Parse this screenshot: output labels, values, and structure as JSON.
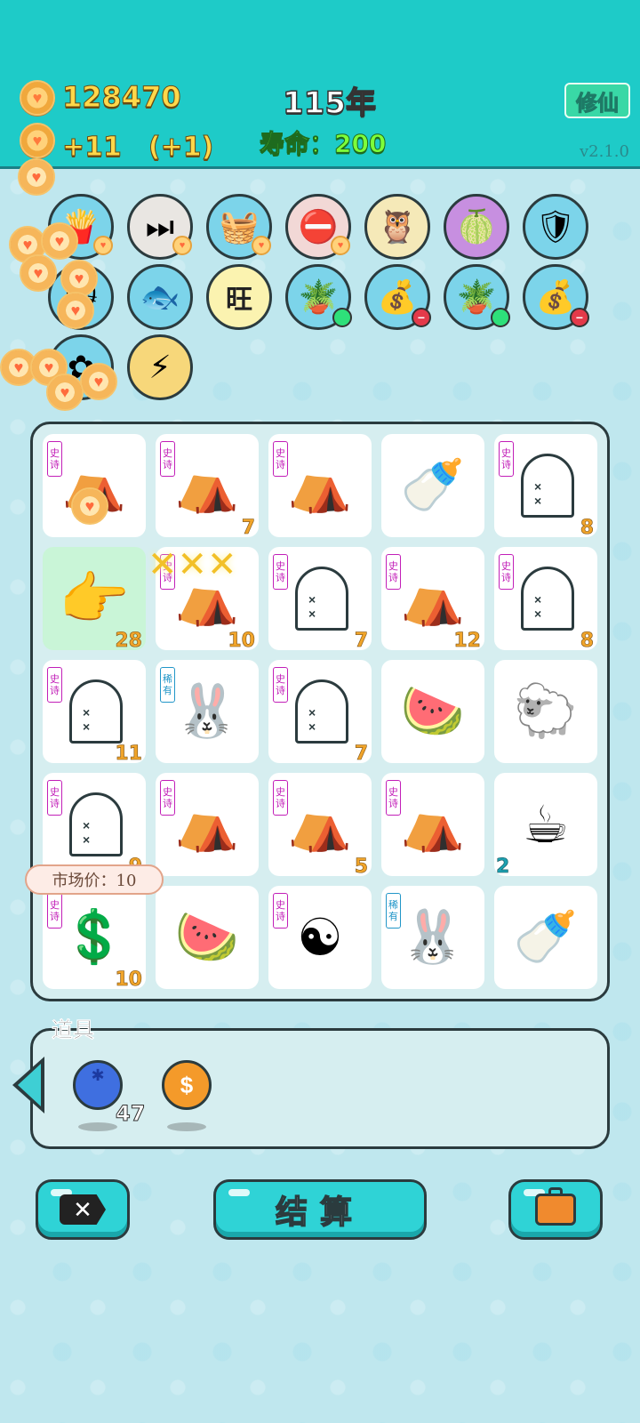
{
  "header": {
    "coins": "128470",
    "income": "+11　(+1)",
    "year": "115年",
    "lifespan": "寿命：200",
    "xiuxian_label": "修仙",
    "version": "v2.1.0"
  },
  "artifacts": [
    {
      "name": "fries",
      "icon": "🍟"
    },
    {
      "name": "skip",
      "icon": "⏭"
    },
    {
      "name": "fruit-basket",
      "icon": "🧺"
    },
    {
      "name": "no-entry",
      "icon": "⛔"
    },
    {
      "name": "owl-glasses",
      "icon": "🦉"
    },
    {
      "name": "pomelo",
      "icon": "🍈"
    },
    {
      "name": "shield",
      "icon": "🛡"
    },
    {
      "name": "cat",
      "icon": "🐱"
    },
    {
      "name": "fish-bowl",
      "icon": "🐟"
    },
    {
      "name": "wang",
      "icon": "旺"
    },
    {
      "name": "flower-pot-1",
      "icon": "🪴"
    },
    {
      "name": "bag-1",
      "icon": "💰"
    },
    {
      "name": "flower-pot-2",
      "icon": "🪴"
    },
    {
      "name": "bag-2",
      "icon": "💰"
    },
    {
      "name": "flower",
      "icon": "✿"
    },
    {
      "name": "lightning",
      "icon": "⚡"
    }
  ],
  "board": {
    "tag_epic": "史诗",
    "tag_rare": "稀有",
    "cells": [
      {
        "icon": "⛺",
        "tag": "epic",
        "num": ""
      },
      {
        "icon": "⛺",
        "tag": "epic",
        "num": "7"
      },
      {
        "icon": "⛺",
        "tag": "epic",
        "num": ""
      },
      {
        "icon": "🍼",
        "tag": "",
        "num": ""
      },
      {
        "icon": "ghost",
        "tag": "epic",
        "num": "8"
      },
      {
        "icon": "👉",
        "tag": "",
        "num": "28"
      },
      {
        "icon": "⛺",
        "tag": "epic",
        "num": "10"
      },
      {
        "icon": "ghost",
        "tag": "epic",
        "num": "7"
      },
      {
        "icon": "⛺",
        "tag": "epic",
        "num": "12"
      },
      {
        "icon": "ghost",
        "tag": "epic",
        "num": "8"
      },
      {
        "icon": "ghost",
        "tag": "epic",
        "num": "11"
      },
      {
        "icon": "🐰",
        "tag": "rare",
        "num": ""
      },
      {
        "icon": "ghost",
        "tag": "epic",
        "num": "7"
      },
      {
        "icon": "🍉",
        "tag": "",
        "num": ""
      },
      {
        "icon": "🐑",
        "tag": "",
        "num": ""
      },
      {
        "icon": "ghost",
        "tag": "epic",
        "num": "9"
      },
      {
        "icon": "⛺",
        "tag": "epic",
        "num": ""
      },
      {
        "icon": "⛺",
        "tag": "epic",
        "num": "5"
      },
      {
        "icon": "⛺",
        "tag": "epic",
        "num": ""
      },
      {
        "icon": "☕",
        "tag": "",
        "num": "2"
      },
      {
        "icon": "💲",
        "tag": "epic",
        "num": "10"
      },
      {
        "icon": "🍉",
        "tag": "",
        "num": ""
      },
      {
        "icon": "☯",
        "tag": "epic",
        "num": ""
      },
      {
        "icon": "🐰",
        "tag": "rare",
        "num": ""
      },
      {
        "icon": "🍼",
        "tag": "",
        "num": ""
      }
    ]
  },
  "tooltip": "市场价：10",
  "items": {
    "title": "道具",
    "list": [
      {
        "name": "blueberry",
        "icon": "●",
        "color": "#3f6fe0",
        "count": "47"
      },
      {
        "name": "coin-item",
        "icon": "$",
        "color": "#f49a2a",
        "count": ""
      }
    ]
  },
  "buttons": {
    "settle_label": "结算"
  }
}
